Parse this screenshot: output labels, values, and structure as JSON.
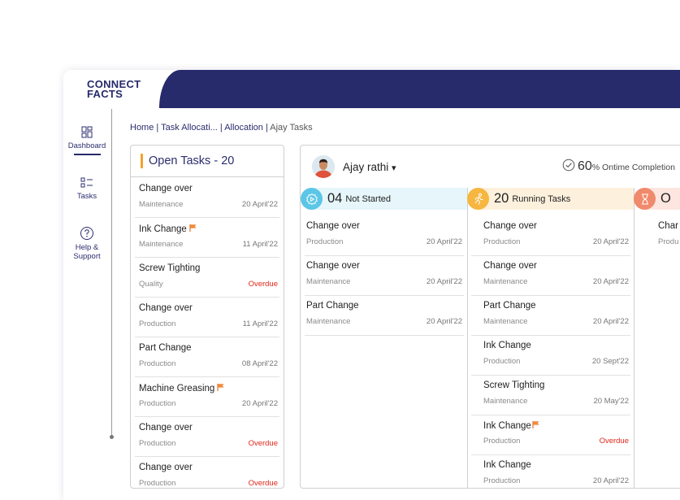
{
  "brand": {
    "logo_line1": "CONNECT",
    "logo_line2": "FACTS"
  },
  "sidebar": {
    "items": [
      {
        "label": "Dashboard",
        "icon": "dashboard-icon",
        "active": true
      },
      {
        "label": "Tasks",
        "icon": "tasks-icon",
        "active": false
      },
      {
        "label": "Help &",
        "label2": "Support",
        "icon": "help-icon",
        "active": false
      }
    ]
  },
  "breadcrumb": {
    "home": "Home",
    "task_allocation": "Task Allocati...",
    "allocation": "Allocation",
    "current": "Ajay Tasks",
    "separator": " | "
  },
  "open_tasks": {
    "title": "Open Tasks - 20",
    "items": [
      {
        "title": "Change over",
        "category": "Maintenance",
        "date": "20 April'22",
        "overdue": false,
        "flag": false
      },
      {
        "title": "Ink Change",
        "category": "Maintenance",
        "date": "11 April'22",
        "overdue": false,
        "flag": true
      },
      {
        "title": "Screw Tighting",
        "category": "Quality",
        "date": "Overdue",
        "overdue": true,
        "flag": false
      },
      {
        "title": "Change over",
        "category": "Production",
        "date": "11 April'22",
        "overdue": false,
        "flag": false
      },
      {
        "title": "Part Change",
        "category": "Production",
        "date": "08 April'22",
        "overdue": false,
        "flag": false
      },
      {
        "title": "Machine Greasing",
        "category": "Production",
        "date": "20 April'22",
        "overdue": false,
        "flag": true
      },
      {
        "title": "Change over",
        "category": "Production",
        "date": "Overdue",
        "overdue": true,
        "flag": false
      },
      {
        "title": "Change over",
        "category": "Production",
        "date": "Overdue",
        "overdue": true,
        "flag": false
      }
    ]
  },
  "user": {
    "name": "Ajay rathi",
    "dropdown_caret": "▾"
  },
  "ontime": {
    "value": "60",
    "unit": "%",
    "label": " Ontime Completion"
  },
  "columns": [
    {
      "count": "04",
      "label": "Not Started",
      "color": "#e6f6fb",
      "icon_color": "#5cc6e6",
      "icon": "play-circle-icon",
      "items": [
        {
          "title": "Change over",
          "category": "Production",
          "date": "20 April'22",
          "overdue": false,
          "flag": false
        },
        {
          "title": "Change over",
          "category": "Maintenance",
          "date": "20 April'22",
          "overdue": false,
          "flag": false
        },
        {
          "title": "Part Change",
          "category": "Maintenance",
          "date": "20 April'22",
          "overdue": false,
          "flag": false
        }
      ]
    },
    {
      "count": "20",
      "label": "Running Tasks",
      "color": "#fdf1dd",
      "icon_color": "#f6b640",
      "icon": "running-person-icon",
      "items": [
        {
          "title": "Change over",
          "category": "Production",
          "date": "20 April'22",
          "overdue": false,
          "flag": false
        },
        {
          "title": "Change over",
          "category": "Maintenance",
          "date": "20 April'22",
          "overdue": false,
          "flag": false
        },
        {
          "title": "Part Change",
          "category": "Maintenance",
          "date": "20 April'22",
          "overdue": false,
          "flag": false
        },
        {
          "title": "Ink Change",
          "category": "Production",
          "date": "20 Sept'22",
          "overdue": false,
          "flag": false
        },
        {
          "title": "Screw Tighting",
          "category": "Maintenance",
          "date": "20 May'22",
          "overdue": false,
          "flag": false
        },
        {
          "title": "Ink Change",
          "category": "Production",
          "date": "Overdue",
          "overdue": true,
          "flag": true
        },
        {
          "title": "Ink Change",
          "category": "Production",
          "date": "20 April'22",
          "overdue": false,
          "flag": false
        }
      ]
    },
    {
      "count": "O",
      "label": "",
      "color": "#fde6e0",
      "icon_color": "#f08a6c",
      "icon": "hourglass-icon",
      "items": [
        {
          "title": "Char",
          "category": "Produ",
          "date": "",
          "overdue": false,
          "flag": false
        }
      ]
    }
  ],
  "colors": {
    "brand_navy": "#272a6b",
    "accent_orange": "#f2a32f",
    "overdue_red": "#e0261b"
  }
}
